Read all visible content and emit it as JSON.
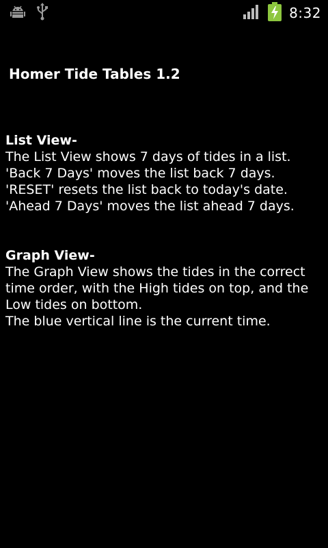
{
  "status_bar": {
    "icons_left": [
      "android-debug-icon",
      "usb-icon"
    ],
    "icons_right": [
      "signal-icon",
      "battery-charging-icon"
    ],
    "time": "8:32",
    "battery_color": "#8DC63F"
  },
  "app": {
    "title": "Homer Tide Tables 1.2"
  },
  "list_view": {
    "heading": "List View-",
    "lines": [
      "The List View shows 7 days of tides in a list.",
      "'Back 7 Days' moves the list back 7 days.",
      "'RESET' resets the list back to today's date.",
      "'Ahead 7 Days' moves the list ahead 7 days."
    ]
  },
  "graph_view": {
    "heading": "Graph View-",
    "lines": [
      "The Graph View shows the tides in the correct",
      "time order, with the High tides on top, and the",
      "Low tides on bottom.",
      "The blue vertical line is the current time."
    ]
  }
}
